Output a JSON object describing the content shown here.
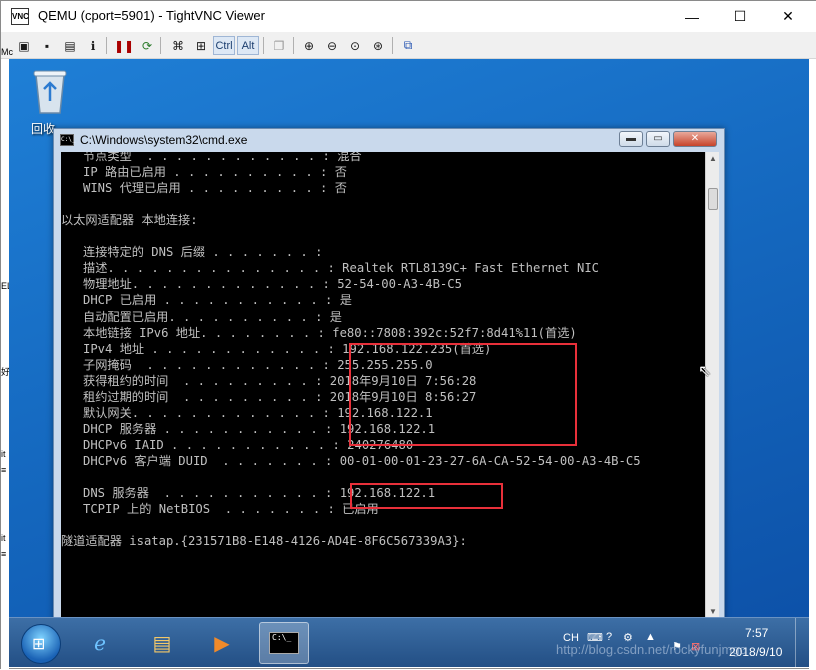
{
  "window": {
    "title": "QEMU (cport=5901) - TightVNC Viewer",
    "app_icon": "VNC",
    "controls": {
      "minimize": "—",
      "maximize": "☐",
      "close": "✕"
    }
  },
  "toolbar": {
    "buttons": [
      "new-connection-icon",
      "save-icon",
      "options-icon",
      "info-icon",
      "pause-icon",
      "refresh-icon",
      "ctrl-alt-del-icon",
      "win-key-icon",
      "full-screen-icon",
      "zoom-in-icon",
      "zoom-out-icon",
      "zoom-100-icon",
      "zoom-fit-icon",
      "file-transfer-icon"
    ],
    "ctrl_label": "Ctrl",
    "alt_label": "Alt"
  },
  "desktop": {
    "recycle_bin_label": "回收",
    "left_edge_fragments": [
      "Mc",
      "EL",
      "好",
      "it",
      "≡",
      "it",
      "≡"
    ]
  },
  "cmd": {
    "title": "C:\\Windows\\system32\\cmd.exe",
    "icon_text": "C:\\_",
    "controls": {
      "minimize": "▬",
      "maximize": "▭",
      "close": "✕"
    },
    "lines": [
      "   节点类型  . . . . . . . . . . . . : 混合",
      "   IP 路由已启用 . . . . . . . . . . : 否",
      "   WINS 代理已启用 . . . . . . . . . : 否",
      "",
      "以太网适配器 本地连接:",
      "",
      "   连接特定的 DNS 后缀 . . . . . . . :",
      "   描述. . . . . . . . . . . . . . . : Realtek RTL8139C+ Fast Ethernet NIC",
      "   物理地址. . . . . . . . . . . . . : 52-54-00-A3-4B-C5",
      "   DHCP 已启用 . . . . . . . . . . . : 是",
      "   自动配置已启用. . . . . . . . . . : 是",
      "   本地链接 IPv6 地址. . . . . . . . : fe80::7808:392c:52f7:8d41%11(首选)",
      "   IPv4 地址 . . . . . . . . . . . . : 192.168.122.235(首选)",
      "   子网掩码  . . . . . . . . . . . . : 255.255.255.0",
      "   获得租约的时间  . . . . . . . . . : 2018年9月10日 7:56:28",
      "   租约过期的时间  . . . . . . . . . : 2018年9月10日 8:56:27",
      "   默认网关. . . . . . . . . . . . . : 192.168.122.1",
      "   DHCP 服务器 . . . . . . . . . . . : 192.168.122.1",
      "   DHCPv6 IAID . . . . . . . . . . . : 240276480",
      "   DHCPv6 客户端 DUID  . . . . . . . : 00-01-00-01-23-27-6A-CA-52-54-00-A3-4B-C5",
      "",
      "   DNS 服务器  . . . . . . . . . . . : 192.168.122.1",
      "   TCPIP 上的 NetBIOS  . . . . . . . : 已启用",
      "",
      "隧道适配器 isatap.{231571B8-E148-4126-AD4E-8F6C567339A3}:"
    ],
    "highlight_color": "#e8303a"
  },
  "taskbar": {
    "start_icon": "windows-logo-icon",
    "pinned": [
      "ie-icon",
      "explorer-folder-icon",
      "media-player-icon"
    ],
    "active_task": "cmd-taskbar-icon",
    "cmd_thumb_text": "C:\\_",
    "tray": {
      "lang": "CH",
      "time": "7:57",
      "date": "2018/9/10"
    }
  },
  "watermark": "http://blog.csdn.net/rockyfunjmgo"
}
